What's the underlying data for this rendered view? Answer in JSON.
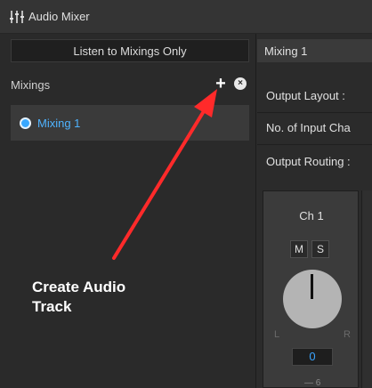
{
  "window": {
    "title": "Audio Mixer",
    "icon": "mixer-sliders-icon"
  },
  "left_panel": {
    "listen_button": "Listen to Mixings Only",
    "mixings_label": "Mixings",
    "add_symbol": "+",
    "remove_symbol": "×",
    "items": [
      {
        "label": "Mixing 1",
        "selected": true
      }
    ]
  },
  "annotation": {
    "text_line1": "Create Audio",
    "text_line2": "Track",
    "color": "#ff2a2a"
  },
  "right_panel": {
    "tab_title": "Mixing 1",
    "output_layout_label": "Output Layout :",
    "input_channels_label": "No. of Input Cha",
    "output_routing_label": "Output Routing :"
  },
  "channel": {
    "name": "Ch 1",
    "mute_label": "M",
    "solo_label": "S",
    "left_label": "L",
    "right_label": "R",
    "pan_value": "0",
    "fader_mark": "— 6"
  },
  "colors": {
    "accent": "#38a8ff",
    "background": "#2b2b2b",
    "panel": "#343434"
  }
}
